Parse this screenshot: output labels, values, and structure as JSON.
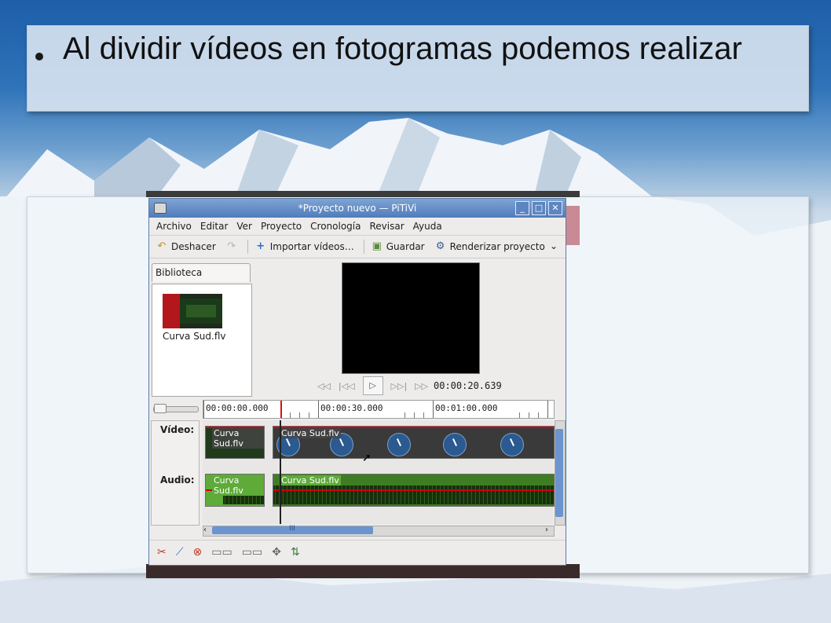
{
  "slide": {
    "title": "Al dividir vídeos en fotogramas podemos realizar"
  },
  "window": {
    "title": "*Proyecto nuevo — PiTiVi",
    "controls": [
      "minimize",
      "maximize",
      "close"
    ]
  },
  "menu": {
    "items": [
      "Archivo",
      "Editar",
      "Ver",
      "Proyecto",
      "Cronología",
      "Revisar",
      "Ayuda"
    ]
  },
  "toolbar": {
    "undo_label": "Deshacer",
    "import_label": "Importar vídeos…",
    "save_label": "Guardar",
    "render_label": "Renderizar proyecto"
  },
  "library": {
    "tab_label": "Biblioteca multimedia",
    "items": [
      {
        "label": "Curva Sud.flv"
      }
    ]
  },
  "viewer": {
    "timecode": "00:00:20.639"
  },
  "timeline": {
    "ruler_labels": [
      "00:00:00.000",
      "00:00:30.000",
      "00:01:00.000"
    ],
    "video_label": "Vídeo:",
    "audio_label": "Audio:",
    "video_clips": [
      "Curva Sud.flv",
      "Curva Sud.flv"
    ],
    "audio_clips": [
      "Curva Sud.flv",
      "Curva Sud.flv"
    ],
    "hscroll_grip": "III"
  },
  "icons": {
    "titlebar": "app-icon",
    "undo": "undo-icon",
    "redo": "redo-icon",
    "import": "plus-icon",
    "save": "save-icon",
    "render": "render-icon",
    "more": "chevron-down-icon"
  }
}
